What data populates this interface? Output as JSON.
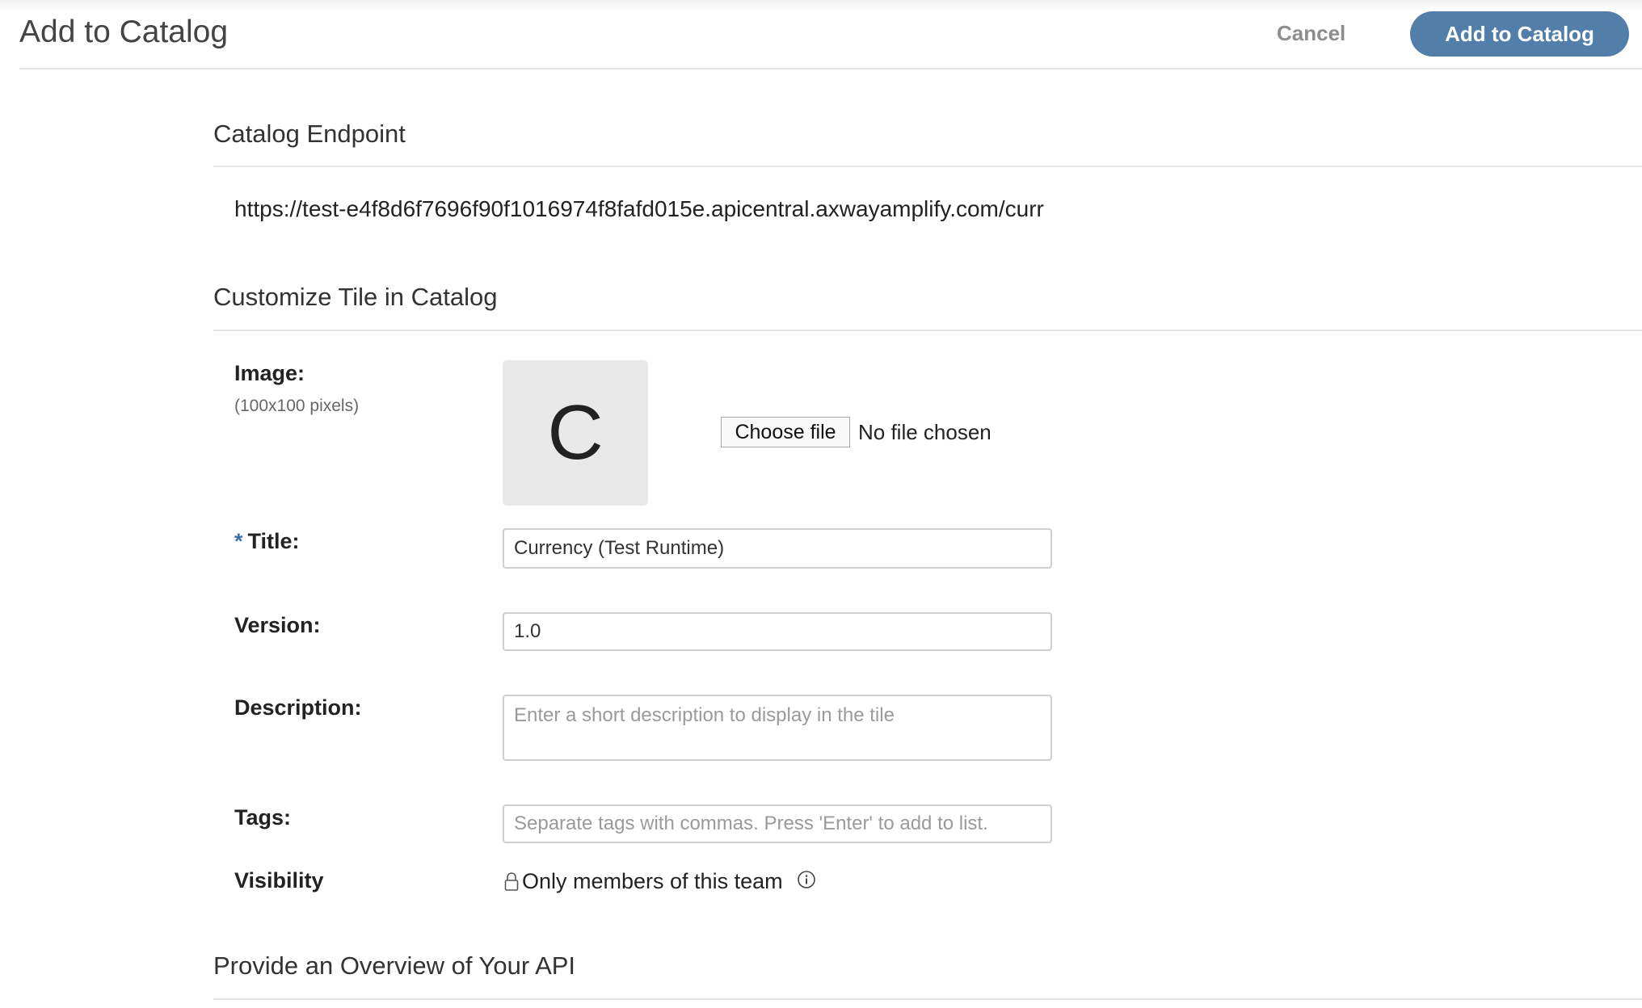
{
  "header": {
    "title": "Add to Catalog",
    "cancel_label": "Cancel",
    "submit_label": "Add to Catalog",
    "accent_color": "#527eaa"
  },
  "catalog_endpoint": {
    "heading": "Catalog Endpoint",
    "url": "https://test-e4f8d6f7696f90f1016974f8fafd015e.apicentral.axwayamplify.com/curr"
  },
  "customize_tile": {
    "heading": "Customize Tile in Catalog",
    "image": {
      "label": "Image:",
      "hint": "(100x100 pixels)",
      "placeholder_letter": "C",
      "choose_file_label": "Choose file",
      "file_status": "No file chosen"
    },
    "title": {
      "required_marker": "*",
      "label": "Title:",
      "value": "Currency (Test Runtime)"
    },
    "version": {
      "label": "Version:",
      "value": "1.0"
    },
    "description": {
      "label": "Description:",
      "placeholder": "Enter a short description to display in the tile"
    },
    "tags": {
      "label": "Tags:",
      "placeholder": "Separate tags with commas. Press 'Enter' to add to list."
    },
    "visibility": {
      "label": "Visibility",
      "value": "Only members of this team",
      "icon": "lock-icon",
      "info_icon": "info-icon"
    }
  },
  "overview": {
    "heading": "Provide an Overview of Your API"
  }
}
